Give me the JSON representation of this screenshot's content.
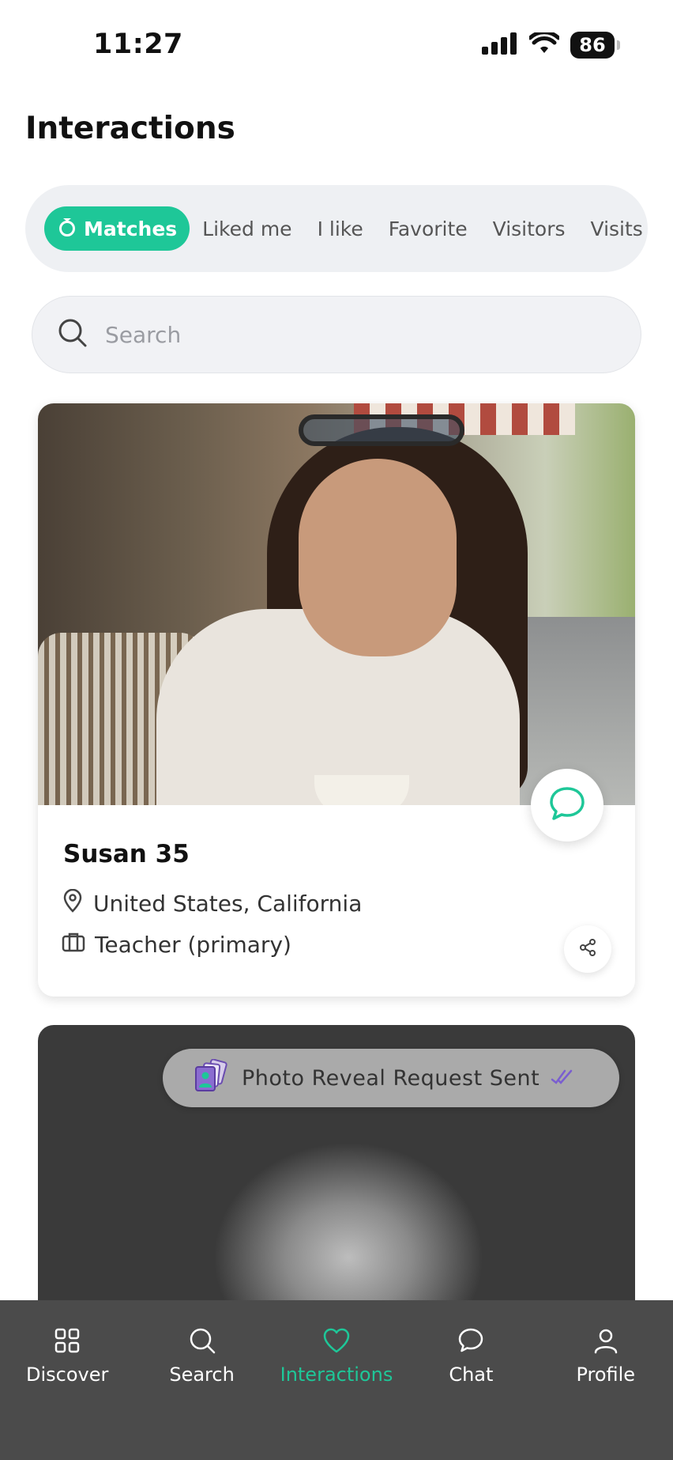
{
  "status": {
    "time": "11:27",
    "battery": "86"
  },
  "header": {
    "title": "Interactions"
  },
  "tabs": [
    {
      "label": "Matches"
    },
    {
      "label": "Liked me"
    },
    {
      "label": "I like"
    },
    {
      "label": "Favorite"
    },
    {
      "label": "Visitors"
    },
    {
      "label": "Visits"
    }
  ],
  "search": {
    "placeholder": "Search",
    "value": ""
  },
  "cards": [
    {
      "name": "Susan 35",
      "location": "United States, California",
      "occupation": "Teacher (primary)"
    }
  ],
  "reveal": {
    "text": "Photo Reveal Request Sent"
  },
  "nav": [
    {
      "label": "Discover",
      "icon": "grid-icon"
    },
    {
      "label": "Search",
      "icon": "search-icon"
    },
    {
      "label": "Interactions",
      "icon": "heart-icon"
    },
    {
      "label": "Chat",
      "icon": "chat-icon"
    },
    {
      "label": "Profile",
      "icon": "person-icon"
    }
  ],
  "colors": {
    "accent": "#1ec798",
    "nav_bg": "#4b4b4b",
    "tab_bg": "#eef0f3"
  }
}
